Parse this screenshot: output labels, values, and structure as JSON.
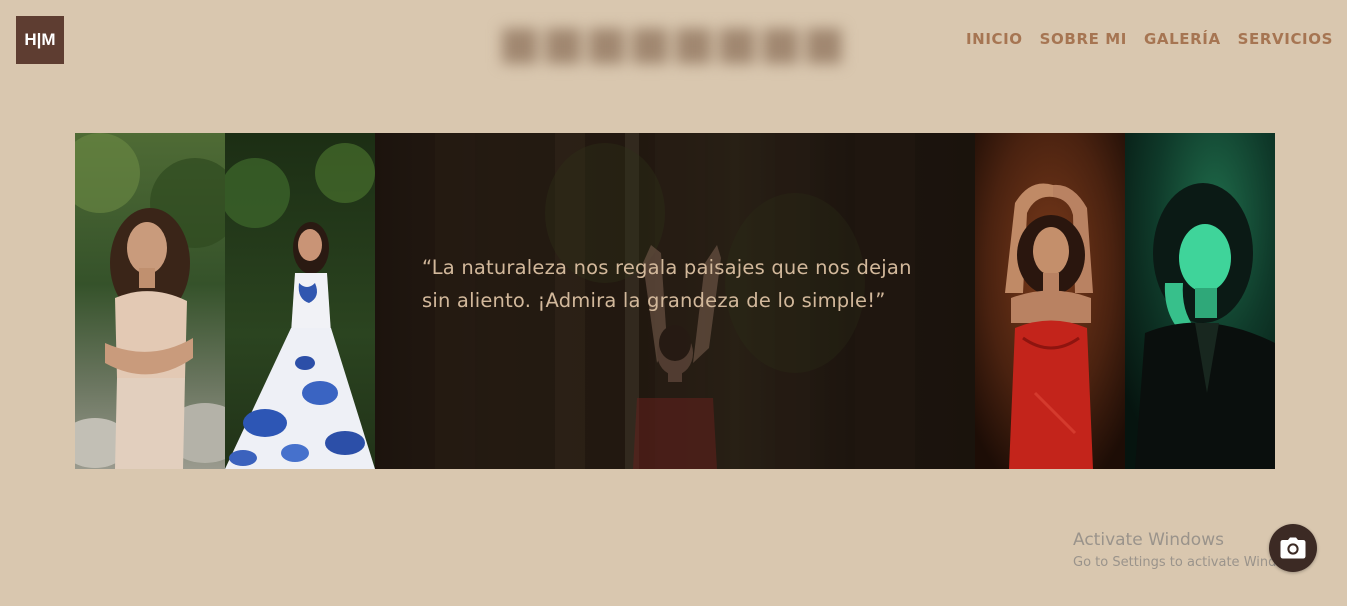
{
  "header": {
    "logo_text": "H|M",
    "nav": [
      {
        "label": "INICIO"
      },
      {
        "label": "SOBRE MI"
      },
      {
        "label": "GALERÍA"
      },
      {
        "label": "SERVICIOS"
      }
    ]
  },
  "gallery": {
    "quote": "“La naturaleza nos regala paisajes que nos dejan sin aliento. ¡Admira la grandeza de lo simple!”"
  },
  "watermark": {
    "title": "Activate Windows",
    "subtitle": "Go to Settings to activate Windows."
  },
  "fab": {
    "icon": "camera-icon"
  },
  "colors": {
    "background": "#d9c7af",
    "logo_bg": "#5e3d31",
    "nav_text": "#a67552",
    "quote_text": "#d2b89b"
  }
}
